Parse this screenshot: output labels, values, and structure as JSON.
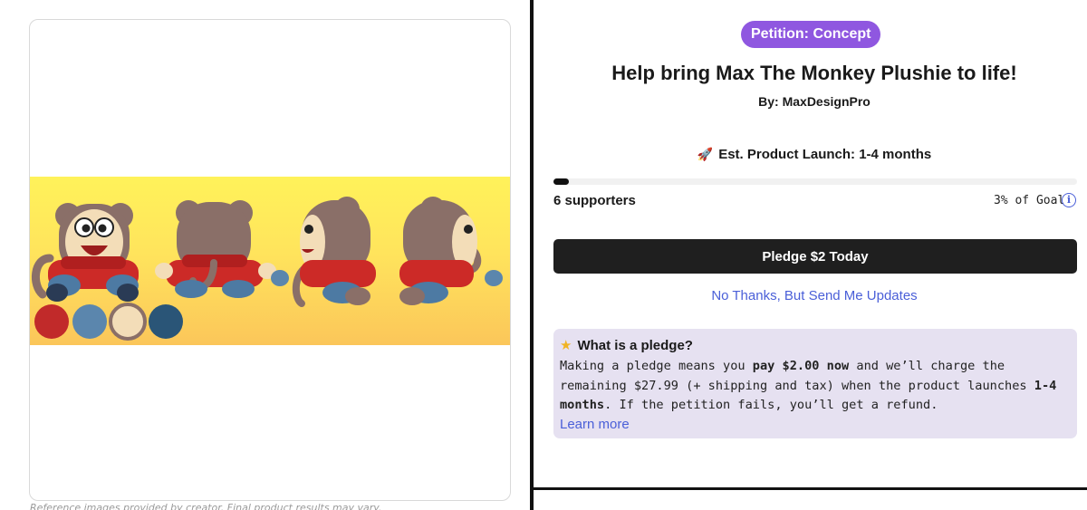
{
  "product_image": {
    "alt_icon": "monkey-plushie-reference-sheet",
    "swatches": [
      "#c12a2a",
      "#5b86ad",
      "#f3ddb8",
      "#2a5577"
    ],
    "caption": "Reference images provided by creator. Final product results may vary."
  },
  "petition": {
    "badge": "Petition: Concept",
    "title": "Help bring Max The Monkey Plushie to life!",
    "byline": "By: MaxDesignPro",
    "launch_icon": "rocket",
    "launch_text": "Est. Product Launch: 1-4 months",
    "progress_percent": 3,
    "supporters_text": "6 supporters",
    "goal_text": "3% of Goal",
    "pledge_button": "Pledge $2 Today",
    "updates_link": "No Thanks, But Send Me Updates"
  },
  "pledge_info": {
    "icon": "star",
    "heading": "What is a pledge?",
    "body_1": "Making a pledge means you ",
    "body_bold_1": "pay $2.00 now",
    "body_2": " and we’ll charge the remaining $27.99 (+ shipping and tax) when the product launches ",
    "body_bold_2": "1-4 months",
    "body_3": ". If the petition fails, you’ll get a refund.",
    "learn_more": "Learn more"
  },
  "colors": {
    "badge": "#8f57e0",
    "button": "#1f1f1f",
    "link": "#4a5fd8",
    "info_box": "#e6e1f1"
  }
}
